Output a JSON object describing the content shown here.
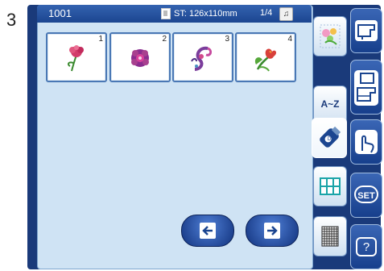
{
  "step_number": "3",
  "header": {
    "design_number": "1001",
    "stitch_area": "ST: 126x110mm",
    "page_indicator": "1/4"
  },
  "designs": [
    {
      "number": "1",
      "icon": "carnation-icon"
    },
    {
      "number": "2",
      "icon": "purple-flower-icon"
    },
    {
      "number": "3",
      "icon": "paisley-icon"
    },
    {
      "number": "4",
      "icon": "tulip-icon"
    }
  ],
  "tools": {
    "alphabet_label": "A~Z"
  },
  "side": {
    "set_label": "SET",
    "help_label": "?"
  },
  "colors": {
    "screen_bg": "#cfe3f4",
    "frame": "#1a3a7a",
    "title_bar": "#1b4590",
    "nav_button": "#12337e"
  }
}
